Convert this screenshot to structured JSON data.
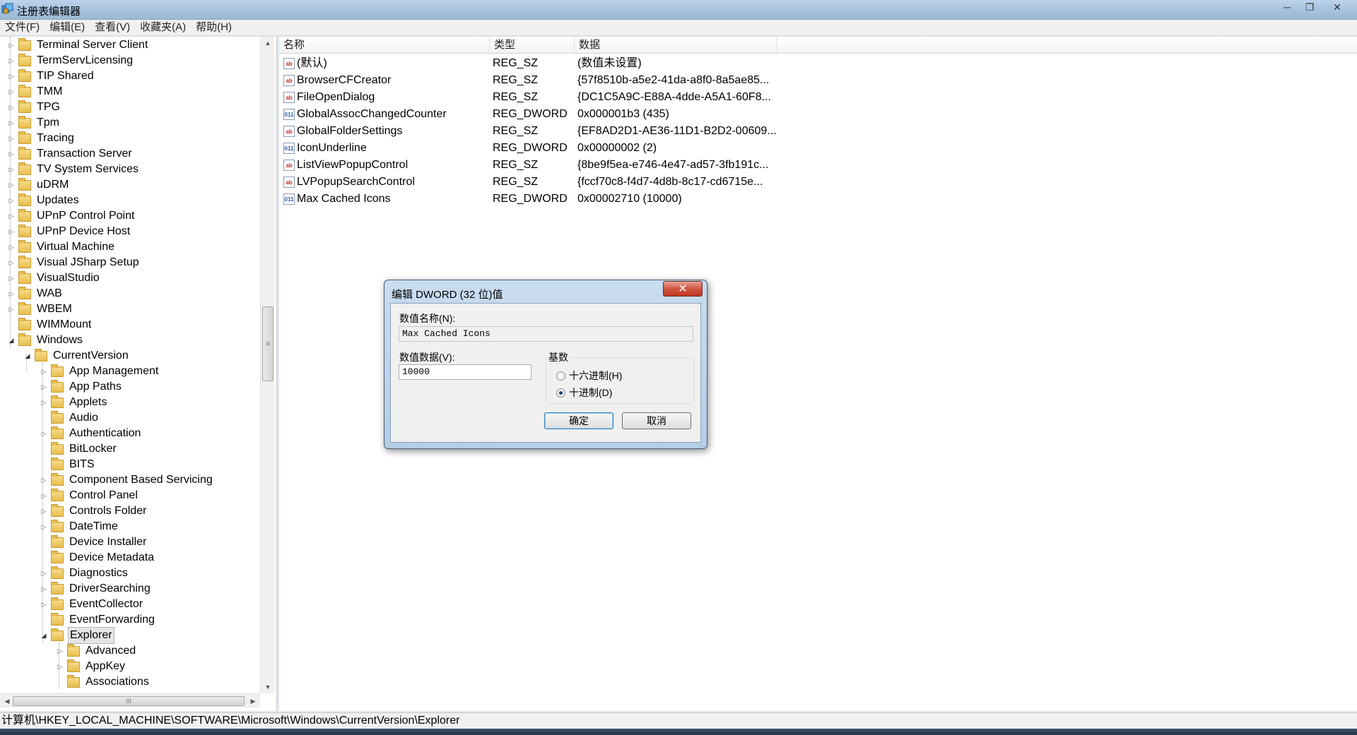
{
  "window": {
    "title": "注册表编辑器",
    "minimize": "─",
    "maximize": "❐",
    "close": "✕"
  },
  "menu": [
    "文件(F)",
    "编辑(E)",
    "查看(V)",
    "收藏夹(A)",
    "帮助(H)"
  ],
  "tree": {
    "level1": [
      {
        "label": "Terminal Server Client",
        "expandable": true
      },
      {
        "label": "TermServLicensing",
        "expandable": true
      },
      {
        "label": "TIP Shared",
        "expandable": true
      },
      {
        "label": "TMM",
        "expandable": true
      },
      {
        "label": "TPG",
        "expandable": true
      },
      {
        "label": "Tpm",
        "expandable": true
      },
      {
        "label": "Tracing",
        "expandable": true
      },
      {
        "label": "Transaction Server",
        "expandable": true
      },
      {
        "label": "TV System Services",
        "expandable": true
      },
      {
        "label": "uDRM",
        "expandable": true
      },
      {
        "label": "Updates",
        "expandable": true
      },
      {
        "label": "UPnP Control Point",
        "expandable": true
      },
      {
        "label": "UPnP Device Host",
        "expandable": true
      },
      {
        "label": "Virtual Machine",
        "expandable": true
      },
      {
        "label": "Visual JSharp Setup",
        "expandable": true
      },
      {
        "label": "VisualStudio",
        "expandable": true
      },
      {
        "label": "WAB",
        "expandable": true
      },
      {
        "label": "WBEM",
        "expandable": true
      },
      {
        "label": "WIMMount",
        "expandable": false
      },
      {
        "label": "Windows",
        "expandable": true,
        "expanded": true
      }
    ],
    "level2": [
      {
        "label": "CurrentVersion",
        "expanded": true
      }
    ],
    "level3": [
      {
        "label": "App Management",
        "expandable": true
      },
      {
        "label": "App Paths",
        "expandable": true
      },
      {
        "label": "Applets",
        "expandable": true
      },
      {
        "label": "Audio",
        "expandable": false
      },
      {
        "label": "Authentication",
        "expandable": true
      },
      {
        "label": "BitLocker",
        "expandable": false
      },
      {
        "label": "BITS",
        "expandable": false
      },
      {
        "label": "Component Based Servicing",
        "expandable": true
      },
      {
        "label": "Control Panel",
        "expandable": true
      },
      {
        "label": "Controls Folder",
        "expandable": true
      },
      {
        "label": "DateTime",
        "expandable": true
      },
      {
        "label": "Device Installer",
        "expandable": false
      },
      {
        "label": "Device Metadata",
        "expandable": false
      },
      {
        "label": "Diagnostics",
        "expandable": true
      },
      {
        "label": "DriverSearching",
        "expandable": true
      },
      {
        "label": "EventCollector",
        "expandable": true
      },
      {
        "label": "EventForwarding",
        "expandable": false
      },
      {
        "label": "Explorer",
        "expandable": true,
        "expanded": true,
        "selected": true
      }
    ],
    "level4": [
      {
        "label": "Advanced",
        "expandable": true
      },
      {
        "label": "AppKey",
        "expandable": true
      },
      {
        "label": "Associations",
        "expandable": false
      }
    ]
  },
  "list": {
    "columns": [
      "名称",
      "类型",
      "数据"
    ],
    "rows": [
      {
        "name": "(默认)",
        "type": "REG_SZ",
        "data": "(数值未设置)",
        "icon": "sz"
      },
      {
        "name": "BrowserCFCreator",
        "type": "REG_SZ",
        "data": "{57f8510b-a5e2-41da-a8f0-8a5ae85...",
        "icon": "sz"
      },
      {
        "name": "FileOpenDialog",
        "type": "REG_SZ",
        "data": "{DC1C5A9C-E88A-4dde-A5A1-60F8...",
        "icon": "sz"
      },
      {
        "name": "GlobalAssocChangedCounter",
        "type": "REG_DWORD",
        "data": "0x000001b3 (435)",
        "icon": "dw"
      },
      {
        "name": "GlobalFolderSettings",
        "type": "REG_SZ",
        "data": "{EF8AD2D1-AE36-11D1-B2D2-00609...",
        "icon": "sz"
      },
      {
        "name": "IconUnderline",
        "type": "REG_DWORD",
        "data": "0x00000002 (2)",
        "icon": "dw"
      },
      {
        "name": "ListViewPopupControl",
        "type": "REG_SZ",
        "data": "{8be9f5ea-e746-4e47-ad57-3fb191c...",
        "icon": "sz"
      },
      {
        "name": "LVPopupSearchControl",
        "type": "REG_SZ",
        "data": "{fccf70c8-f4d7-4d8b-8c17-cd6715e...",
        "icon": "sz"
      },
      {
        "name": "Max Cached Icons",
        "type": "REG_DWORD",
        "data": "0x00002710 (10000)",
        "icon": "dw"
      }
    ]
  },
  "icons": {
    "string_value": "ab",
    "dword_value": "011"
  },
  "status": {
    "path": "计算机\\HKEY_LOCAL_MACHINE\\SOFTWARE\\Microsoft\\Windows\\CurrentVersion\\Explorer"
  },
  "dialog": {
    "title": "编辑 DWORD (32 位)值",
    "close": "✕",
    "name_label": "数值名称(N):",
    "name_value": "Max Cached Icons",
    "data_label": "数值数据(V):",
    "data_value": "10000",
    "base_label": "基数",
    "hex_label": "十六进制(H)",
    "dec_label": "十进制(D)",
    "base_selected": "decimal",
    "ok_label": "确定",
    "cancel_label": "取消"
  },
  "colors": {
    "titlebar": "#a8c3df",
    "dialog_close": "#c0381f",
    "string_icon": "#c0282d",
    "dword_icon": "#2b58b5"
  }
}
